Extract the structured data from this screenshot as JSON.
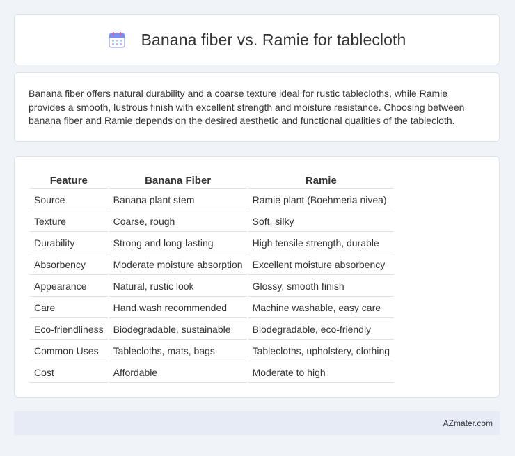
{
  "header": {
    "title": "Banana fiber vs. Ramie for tablecloth",
    "icon": "calendar-icon"
  },
  "description": "Banana fiber offers natural durability and a coarse texture ideal for rustic tablecloths, while Ramie provides a smooth, lustrous finish with excellent strength and moisture resistance. Choosing between banana fiber and Ramie depends on the desired aesthetic and functional qualities of the tablecloth.",
  "table": {
    "headers": [
      "Feature",
      "Banana Fiber",
      "Ramie"
    ],
    "rows": [
      [
        "Source",
        "Banana plant stem",
        "Ramie plant (Boehmeria nivea)"
      ],
      [
        "Texture",
        "Coarse, rough",
        "Soft, silky"
      ],
      [
        "Durability",
        "Strong and long-lasting",
        "High tensile strength, durable"
      ],
      [
        "Absorbency",
        "Moderate moisture absorption",
        "Excellent moisture absorbency"
      ],
      [
        "Appearance",
        "Natural, rustic look",
        "Glossy, smooth finish"
      ],
      [
        "Care",
        "Hand wash recommended",
        "Machine washable, easy care"
      ],
      [
        "Eco-friendliness",
        "Biodegradable, sustainable",
        "Biodegradable, eco-friendly"
      ],
      [
        "Common Uses",
        "Tablecloths, mats, bags",
        "Tablecloths, upholstery, clothing"
      ],
      [
        "Cost",
        "Affordable",
        "Moderate to high"
      ]
    ]
  },
  "footer": {
    "brand": "AZmater.com"
  },
  "colors": {
    "background": "#f0f3f8",
    "card": "#ffffff",
    "border": "#dde3ec",
    "footer": "#e6ebf5",
    "icon_accent": "#7b8ef0",
    "icon_rings": "#e85a8a"
  }
}
